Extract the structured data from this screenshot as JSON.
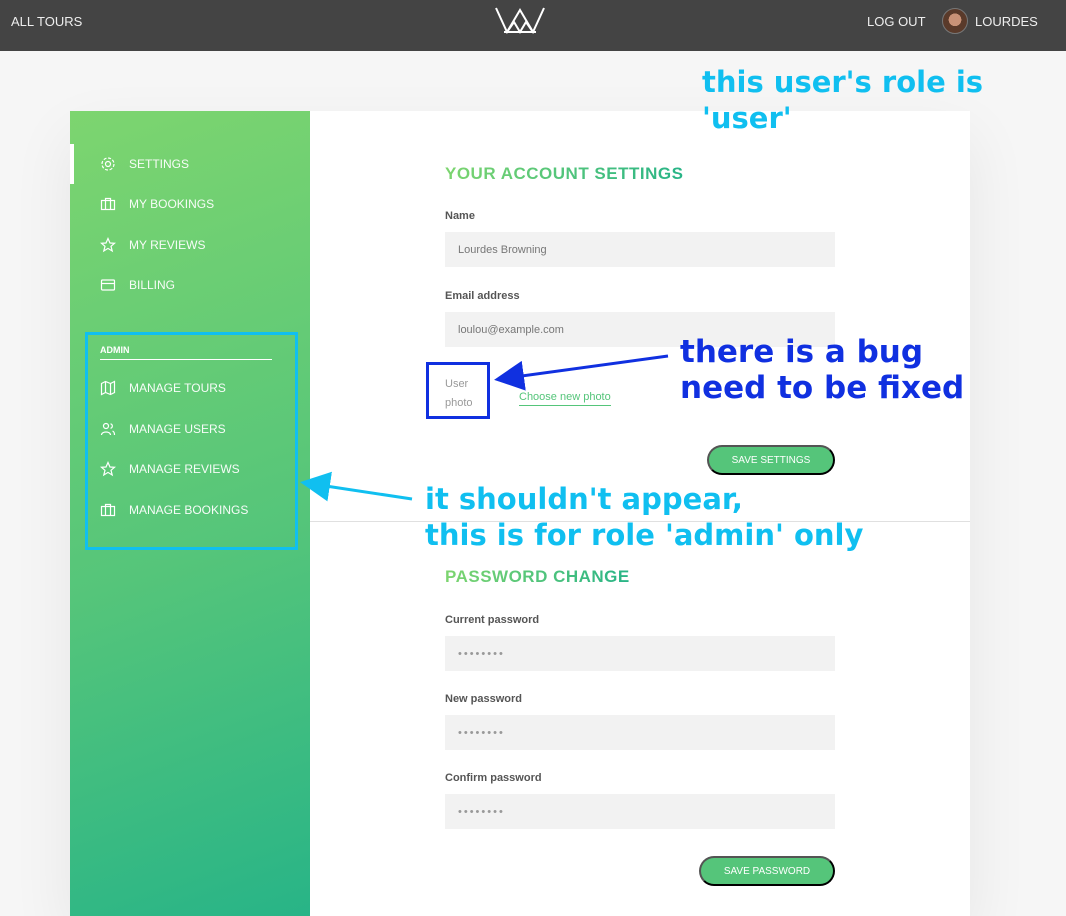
{
  "header": {
    "all_tours": "ALL TOURS",
    "log_out": "LOG OUT",
    "user_name": "LOURDES"
  },
  "sidebar": {
    "items": [
      {
        "label": "SETTINGS",
        "icon": "settings-icon",
        "active": true
      },
      {
        "label": "MY BOOKINGS",
        "icon": "briefcase-icon"
      },
      {
        "label": "MY REVIEWS",
        "icon": "star-icon"
      },
      {
        "label": "BILLING",
        "icon": "credit-card-icon"
      }
    ],
    "admin_heading": "ADMIN",
    "admin_items": [
      {
        "label": "MANAGE TOURS",
        "icon": "map-icon"
      },
      {
        "label": "MANAGE USERS",
        "icon": "users-icon"
      },
      {
        "label": "MANAGE REVIEWS",
        "icon": "star-icon"
      },
      {
        "label": "MANAGE BOOKINGS",
        "icon": "briefcase-icon"
      }
    ]
  },
  "account": {
    "title": "YOUR ACCOUNT SETTINGS",
    "name_label": "Name",
    "name_value": "Lourdes Browning",
    "email_label": "Email address",
    "email_value": "loulou@example.com",
    "photo_alt": "User photo",
    "choose_photo": "Choose new photo",
    "save_button": "SAVE SETTINGS"
  },
  "password": {
    "title": "PASSWORD CHANGE",
    "current_label": "Current password",
    "new_label": "New password",
    "confirm_label": "Confirm password",
    "placeholder": "••••••••",
    "save_button": "SAVE PASSWORD"
  },
  "annotations": {
    "role_note": "this user's role is 'user'",
    "bug_note_line1": "there is a bug",
    "bug_note_line2": "need to be fixed",
    "admin_note_line1": "it shouldn't appear,",
    "admin_note_line2": "this is for role 'admin' only"
  },
  "colors": {
    "header_bg": "#444444",
    "green": "#55c57a",
    "annotation_cyan": "#10bff0",
    "annotation_blue": "#1030e0"
  }
}
